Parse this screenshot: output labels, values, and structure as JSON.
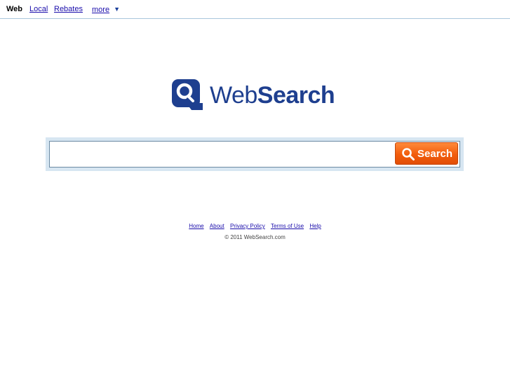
{
  "nav": {
    "tabs": [
      {
        "label": "Web",
        "active": true
      },
      {
        "label": "Local",
        "active": false
      },
      {
        "label": "Rebates",
        "active": false
      }
    ],
    "more_label": "more",
    "more_caret": "▼"
  },
  "logo": {
    "text_light": "Web",
    "text_bold": "Search",
    "icon": "magnifier-q-icon"
  },
  "search": {
    "value": "",
    "placeholder": "",
    "button_label": "Search",
    "button_icon": "search-icon"
  },
  "footer": {
    "links": [
      "Home",
      "About",
      "Privacy Policy",
      "Terms of Use",
      "Help"
    ],
    "copyright": "© 2011 WebSearch.com"
  },
  "colors": {
    "brand_blue": "#1e3f8f",
    "link": "#1a0dab",
    "button_orange": "#f25c0c",
    "search_frame": "#d7e6f2"
  }
}
